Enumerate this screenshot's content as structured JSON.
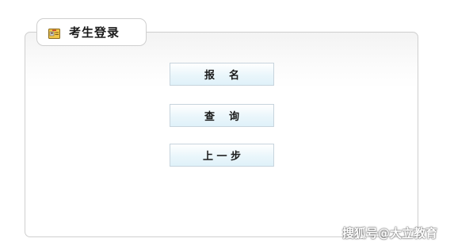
{
  "tab": {
    "icon": "id-card-icon",
    "title": "考生登录"
  },
  "buttons": {
    "register": "报    名",
    "query": "查    询",
    "back": "上 一 步"
  },
  "watermark": "搜狐号@大立教育"
}
